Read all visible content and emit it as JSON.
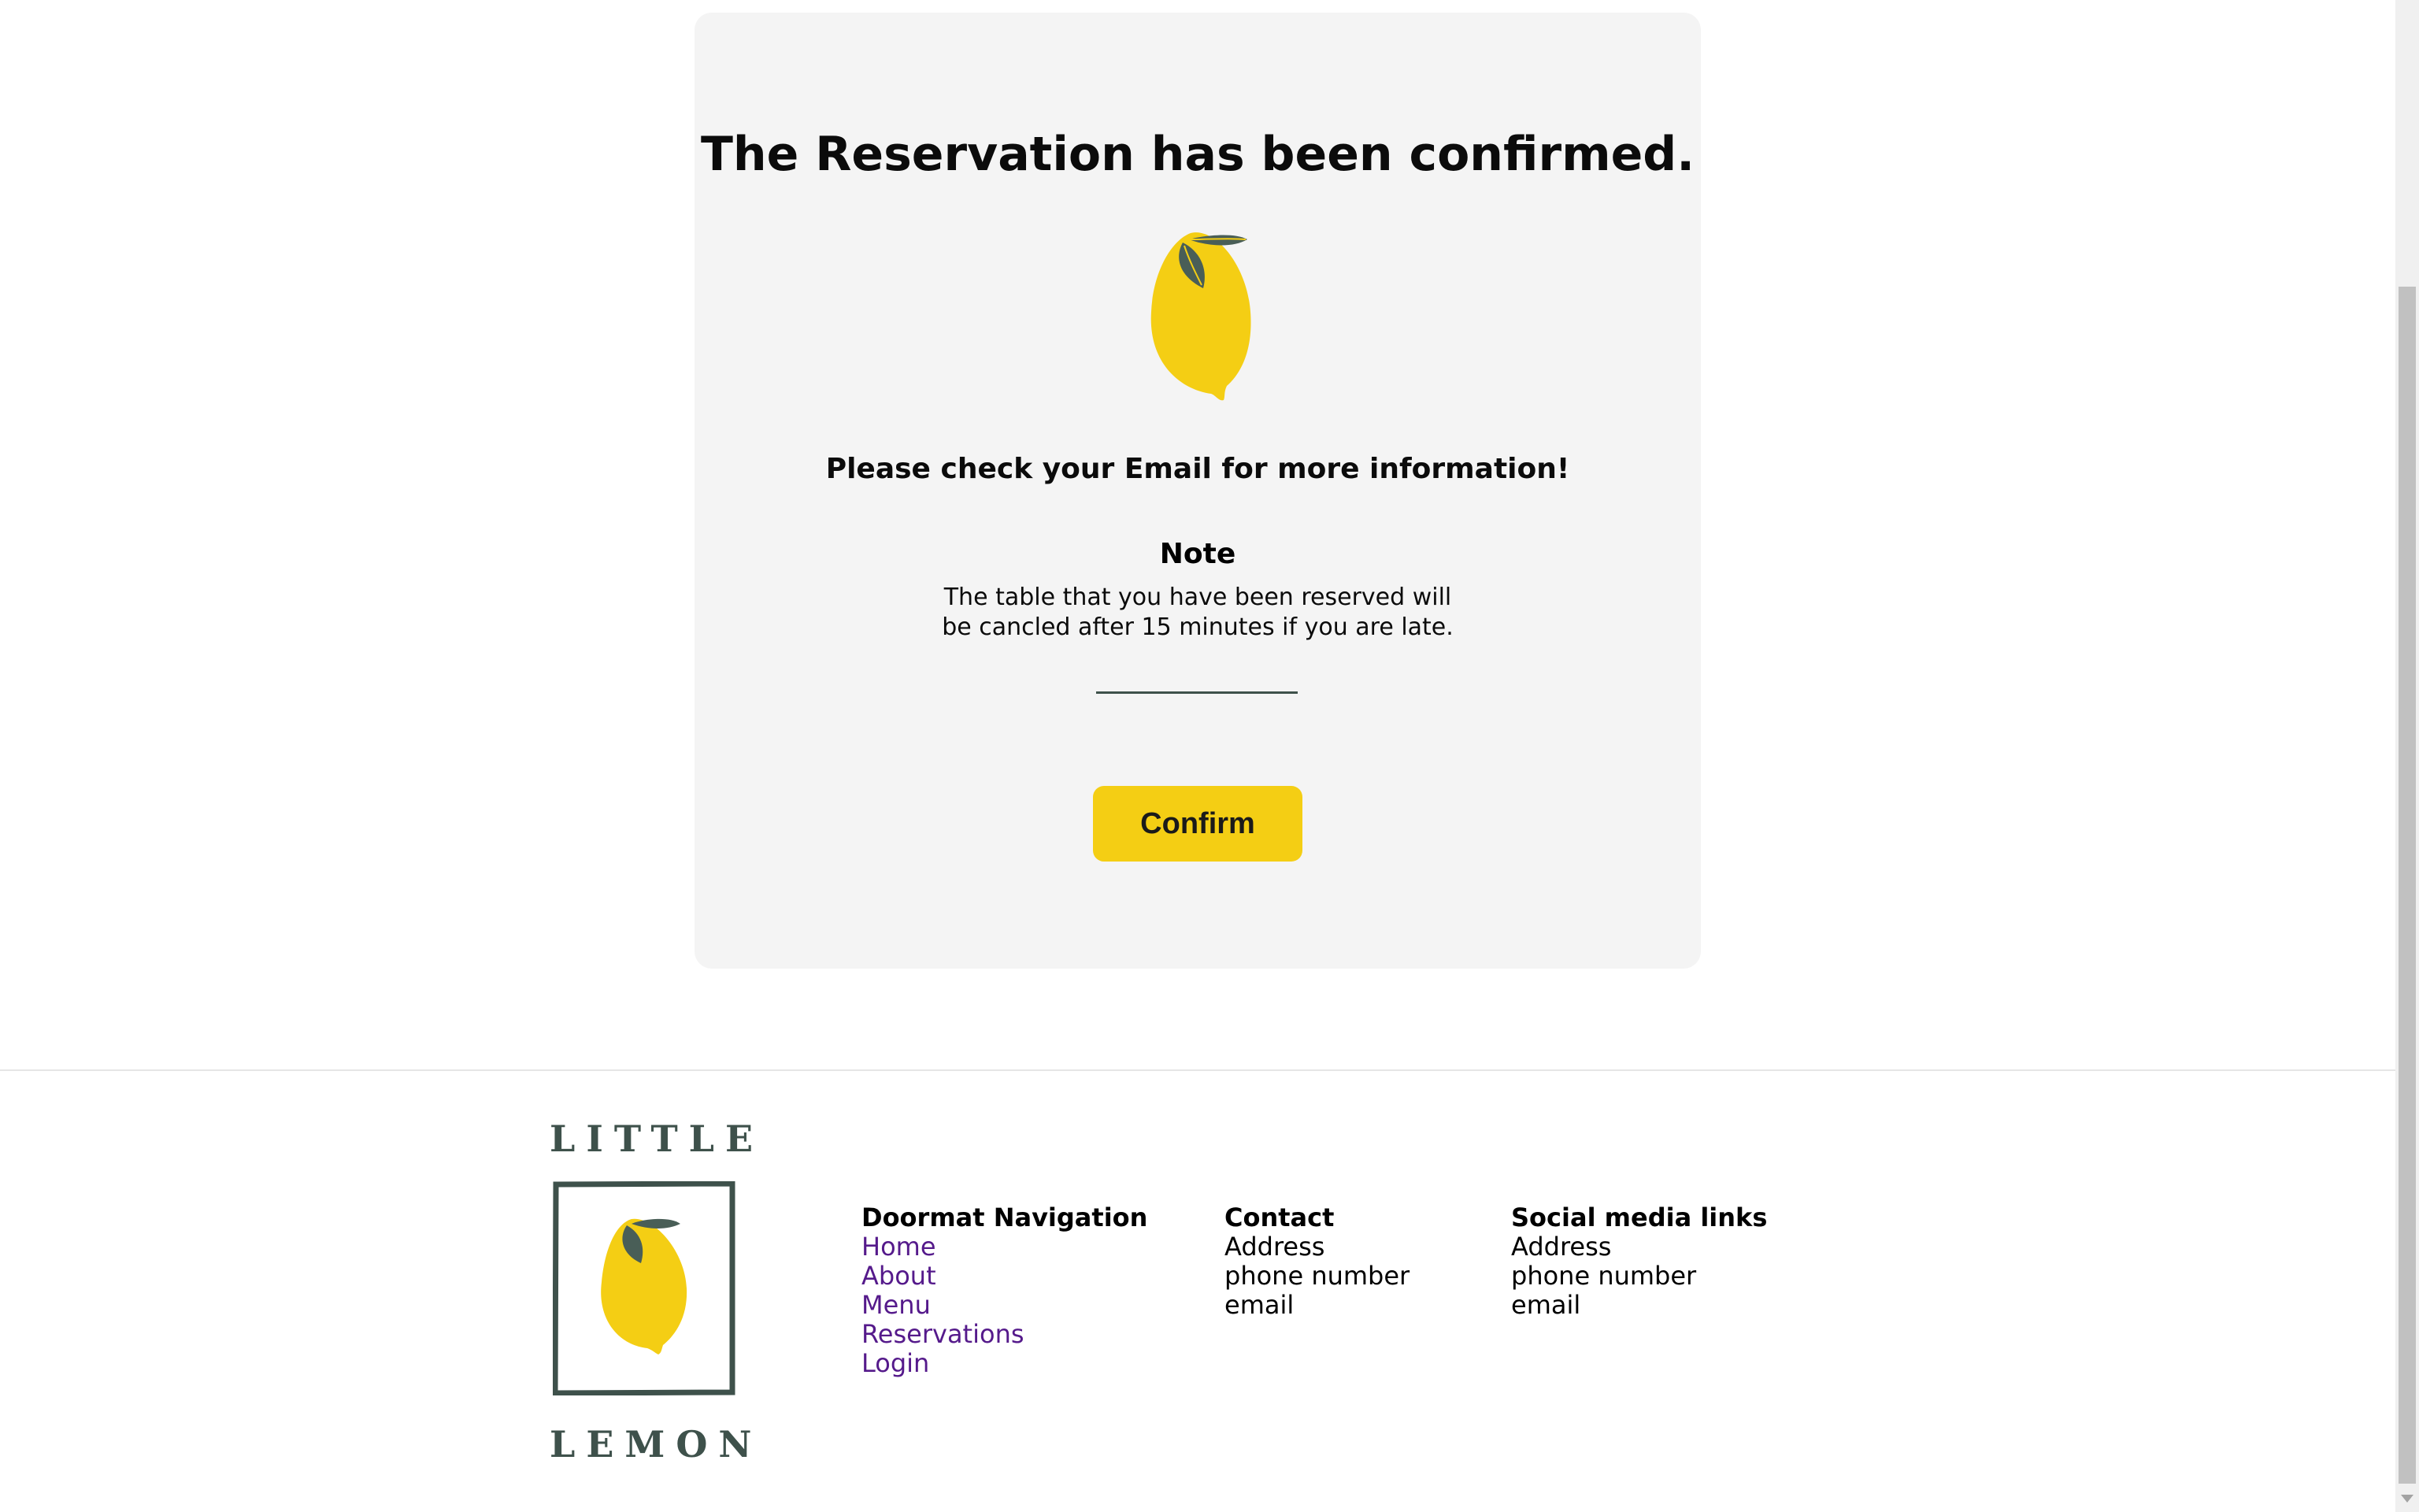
{
  "confirmation": {
    "title": "The Reservation has been confirmed.",
    "message": "Please check your Email for more information!",
    "note_heading": "Note",
    "note_text": "The table that you have been reserved will be cancled after 15 minutes if you are late.",
    "confirm_label": "Confirm",
    "icon": "lemon-icon"
  },
  "footer": {
    "logo": {
      "top_word": "LITTLE",
      "bottom_word": "LEMON"
    },
    "navigation": {
      "heading": "Doormat Navigation",
      "links": [
        "Home",
        "About",
        "Menu",
        "Reservations",
        "Login"
      ]
    },
    "contact": {
      "heading": "Contact",
      "items": [
        "Address",
        "phone number",
        "email"
      ]
    },
    "social": {
      "heading": "Social media links",
      "items": [
        "Address",
        "phone number",
        "email"
      ]
    }
  },
  "colors": {
    "accent_yellow": "#F4CE14",
    "brand_green": "#3E514B",
    "card_background": "#F4F4F4",
    "link_purple": "#551A8B"
  }
}
